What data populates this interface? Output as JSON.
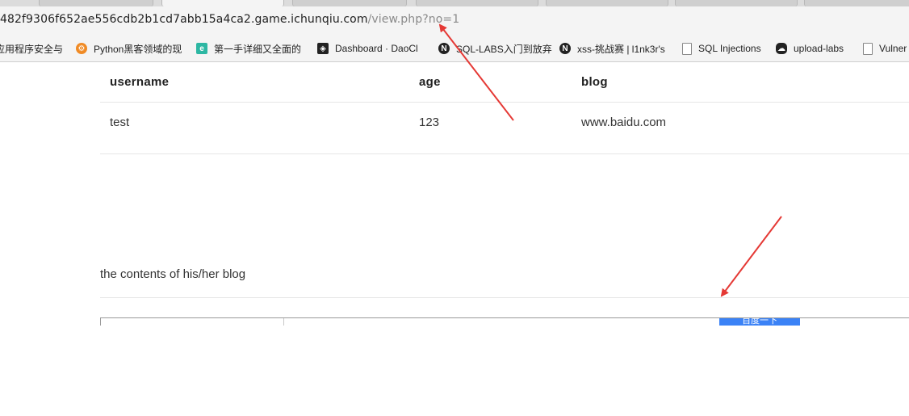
{
  "browser": {
    "url_host": "482f9306f652ae556cdb2b1cd7abb15a4ca2.game.ichunqiu.com",
    "url_path": "/view.php?no=1",
    "bookmarks": [
      {
        "label": "应用程序安全与",
        "icon": "page-icon",
        "color": "#f4f4f4"
      },
      {
        "label": "Python黑客领域的现",
        "icon": "orange-gear-icon",
        "color": "#f08a24"
      },
      {
        "label": "第一手详细又全面的",
        "icon": "teal-e-icon",
        "color": "#2db7a3"
      },
      {
        "label": "Dashboard · DaoCl",
        "icon": "daocloud-icon",
        "color": "#222222"
      },
      {
        "label": "SQL-LABS入门到放弃",
        "icon": "n-icon",
        "color": "#222222"
      },
      {
        "label": "xss-挑战赛 | l1nk3r's",
        "icon": "n-icon",
        "color": "#222222"
      },
      {
        "label": "SQL Injections",
        "icon": "page-icon",
        "color": "#f4f4f4"
      },
      {
        "label": "upload-labs",
        "icon": "cloud-icon",
        "color": "#222222"
      },
      {
        "label": "Vulner",
        "icon": "page-icon",
        "color": "#f4f4f4"
      }
    ]
  },
  "table": {
    "headers": [
      "username",
      "age",
      "blog"
    ],
    "rows": [
      [
        "test",
        "123",
        "www.baidu.com"
      ]
    ]
  },
  "blog_section": {
    "label": "the contents of his/her blog",
    "embedded_button_label": "百度一下"
  },
  "annotation_color": "#e53935"
}
